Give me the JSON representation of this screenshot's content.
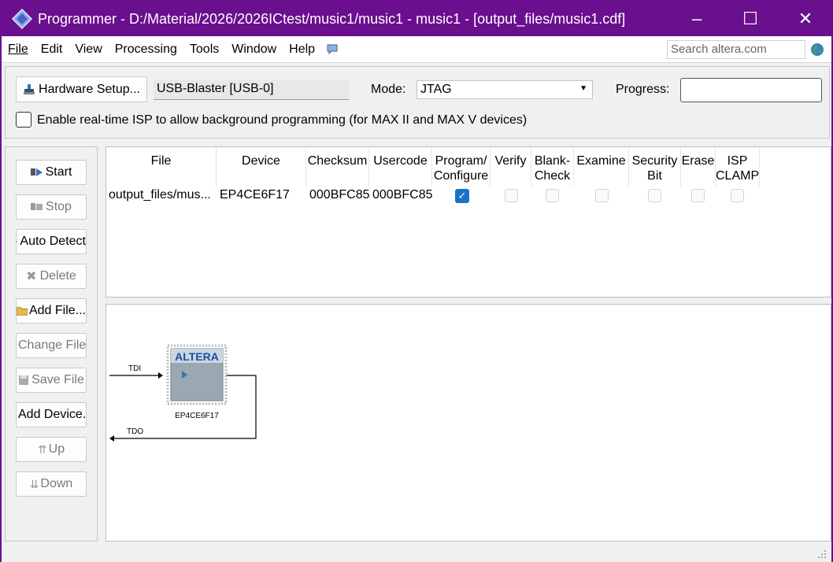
{
  "window": {
    "title": "Programmer - D:/Material/2026/2026ICtest/music1/music1 - music1 - [output_files/music1.cdf]",
    "controls": {
      "minimize": "–",
      "maximize": "☐",
      "close": "✕"
    },
    "accent": "#6a0f8e"
  },
  "menubar": {
    "items": [
      "File",
      "Edit",
      "View",
      "Processing",
      "Tools",
      "Window",
      "Help"
    ],
    "search_placeholder": "Search altera.com"
  },
  "toolbar": {
    "hardware_setup_label": "Hardware Setup...",
    "hardware_value": "USB-Blaster [USB-0]",
    "mode_label": "Mode:",
    "mode_value": "JTAG",
    "progress_label": "Progress:",
    "isp_label": "Enable real-time ISP to allow background programming (for MAX II and MAX V devices)",
    "isp_checked": false
  },
  "sidebar": {
    "buttons": [
      {
        "label": "Start",
        "icon": "play-icon",
        "enabled": true
      },
      {
        "label": "Stop",
        "icon": "stop-icon",
        "enabled": false
      },
      {
        "label": "Auto Detect",
        "icon": "auto-detect-icon",
        "enabled": true
      },
      {
        "label": "Delete",
        "icon": "delete-icon",
        "enabled": false
      },
      {
        "label": "Add File...",
        "icon": "folder-icon",
        "enabled": true
      },
      {
        "label": "Change File...",
        "icon": "change-file-icon",
        "enabled": false
      },
      {
        "label": "Save File",
        "icon": "save-icon",
        "enabled": false
      },
      {
        "label": "Add Device...",
        "icon": "add-device-icon",
        "enabled": true
      },
      {
        "label": "Up",
        "icon": "up-icon",
        "enabled": false
      },
      {
        "label": "Down",
        "icon": "down-icon",
        "enabled": false
      }
    ]
  },
  "table": {
    "headers": [
      {
        "line1": "File",
        "line2": ""
      },
      {
        "line1": "Device",
        "line2": ""
      },
      {
        "line1": "Checksum",
        "line2": ""
      },
      {
        "line1": "Usercode",
        "line2": ""
      },
      {
        "line1": "Program/",
        "line2": "Configure"
      },
      {
        "line1": "Verify",
        "line2": ""
      },
      {
        "line1": "Blank-",
        "line2": "Check"
      },
      {
        "line1": "Examine",
        "line2": ""
      },
      {
        "line1": "Security",
        "line2": "Bit"
      },
      {
        "line1": "Erase",
        "line2": ""
      },
      {
        "line1": "ISP",
        "line2": "CLAMP"
      }
    ],
    "rows": [
      {
        "file": "output_files/mus...",
        "device": "EP4CE6F17",
        "checksum": "000BFC85",
        "usercode": "000BFC85",
        "program_configure": true,
        "verify": false,
        "blank_check": false,
        "examine": false,
        "security_bit": false,
        "erase": false,
        "isp_clamp": false
      }
    ]
  },
  "diagram": {
    "tdi_label": "TDI",
    "tdo_label": "TDO",
    "chip_logo": "ALTERA",
    "chip_device": "EP4CE6F17"
  }
}
